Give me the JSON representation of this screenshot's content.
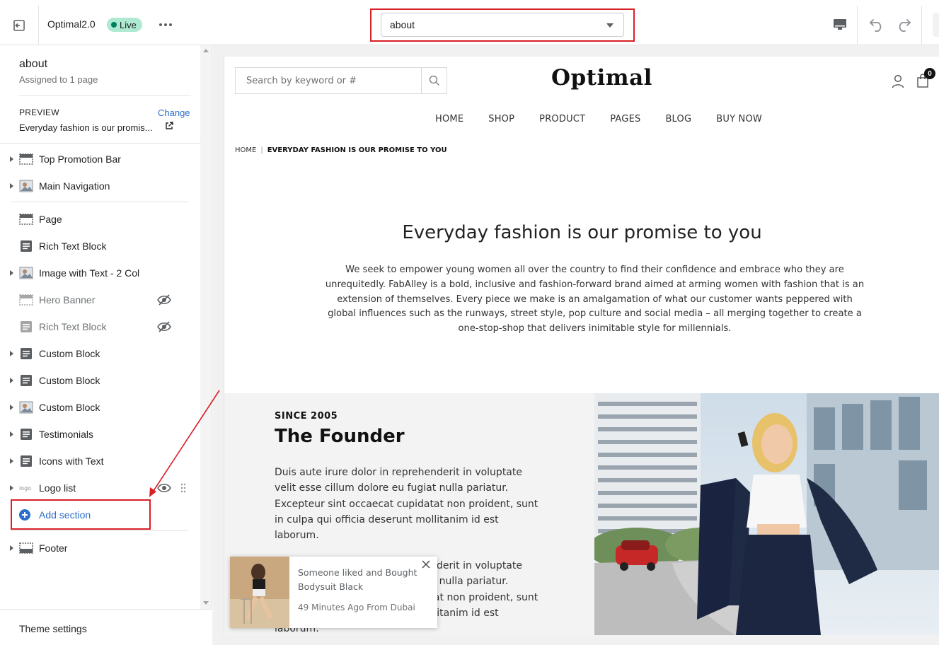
{
  "topbar": {
    "theme_name": "Optimal2.0",
    "status_badge": "Live",
    "page_selector_value": "about"
  },
  "sidebar": {
    "template_title": "about",
    "assigned": "Assigned to 1 page",
    "preview_label": "PREVIEW",
    "change_link": "Change",
    "preview_value": "Everyday fashion is our promis...",
    "header_sections": [
      {
        "label": "Top Promotion Bar",
        "icon": "section-icon"
      },
      {
        "label": "Main Navigation",
        "icon": "image-section-icon"
      }
    ],
    "template_sections": [
      {
        "label": "Page",
        "icon": "section-icon",
        "expandable": false,
        "hidden": false
      },
      {
        "label": "Rich Text Block",
        "icon": "text-block-icon",
        "expandable": false,
        "hidden": false
      },
      {
        "label": "Image with Text - 2 Col",
        "icon": "image-section-icon",
        "expandable": true,
        "hidden": false
      },
      {
        "label": "Hero Banner",
        "icon": "section-icon",
        "expandable": false,
        "hidden": true
      },
      {
        "label": "Rich Text Block",
        "icon": "text-block-icon",
        "expandable": false,
        "hidden": true
      },
      {
        "label": "Custom Block",
        "icon": "text-block-icon",
        "expandable": true,
        "hidden": false
      },
      {
        "label": "Custom Block",
        "icon": "text-block-icon",
        "expandable": true,
        "hidden": false
      },
      {
        "label": "Custom Block",
        "icon": "image-section-icon",
        "expandable": true,
        "hidden": false
      },
      {
        "label": "Testimonials",
        "icon": "text-block-icon",
        "expandable": true,
        "hidden": false
      },
      {
        "label": "Icons with Text",
        "icon": "text-block-icon",
        "expandable": true,
        "hidden": false
      },
      {
        "label": "Logo list",
        "icon": "logo-list-icon",
        "expandable": true,
        "hidden": false
      }
    ],
    "add_section": "Add section",
    "footer_section": "Footer",
    "theme_settings": "Theme settings"
  },
  "preview": {
    "search_placeholder": "Search by keyword or #",
    "logo": "Optimal",
    "cart_count": "0",
    "nav": [
      "HOME",
      "SHOP",
      "PRODUCT",
      "PAGES",
      "BLOG",
      "BUY NOW"
    ],
    "breadcrumb_home": "HOME",
    "breadcrumb_sep": "|",
    "breadcrumb_current": "EVERYDAY FASHION IS OUR PROMISE TO YOU",
    "heading": "Everyday fashion is our promise to you",
    "intro": "We seek to empower young women all over the country to find their confidence and embrace who they are unrequitedly. FabAlley is a bold, inclusive and fashion-forward brand aimed at arming women with fashion that is an extension of themselves. Every piece we make is an amalgamation of what our customer wants peppered with global influences such as the runways, street style, pop culture and social media – all merging together to create a one-stop-shop that delivers inimitable style for millennials.",
    "since": "SINCE 2005",
    "founder_title": "The Founder",
    "founder_p1": "Duis aute irure dolor in reprehenderit in voluptate velit esse cillum dolore eu fugiat nulla pariatur. Excepteur sint occaecat cupidatat non proident, sunt in culpa qui officia deserunt mollitanim id est laborum.",
    "founder_p2": "Duis aute irure dolor in reprehenderit in voluptate velit esse cillum dolore eu fugiat nulla pariatur. Excepteur sint occaecat cupidatat non proident, sunt in culpa qui officia deserunt mollitanim id est laborum.",
    "popup": {
      "line1": "Someone liked and Bought",
      "line2": "Bodysuit Black",
      "line3": "49 Minutes Ago From Dubai"
    }
  },
  "colors": {
    "accent_blue": "#2c6ecb",
    "annotation_red": "#d71f26",
    "live_badge_bg": "#aee9d1",
    "live_dot": "#007f5f"
  }
}
